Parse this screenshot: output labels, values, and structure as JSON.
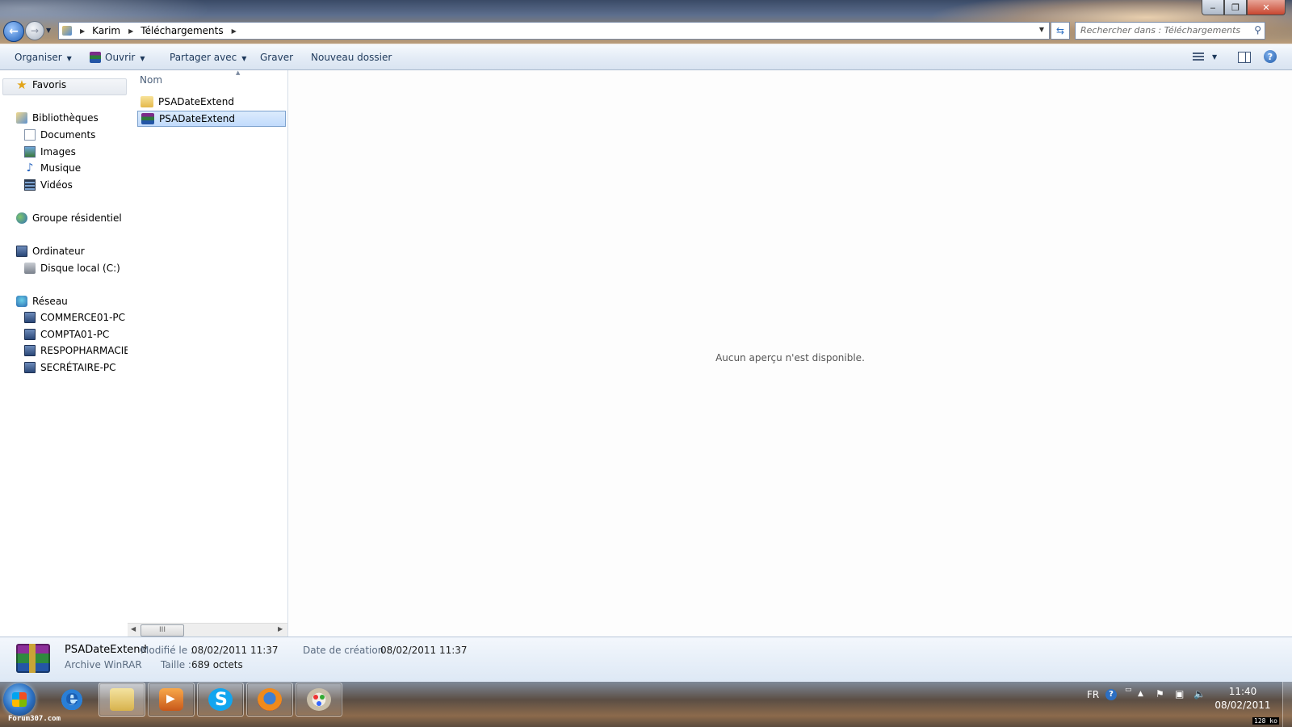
{
  "window": {
    "controls": {
      "minimize": "‒",
      "maximize": "❐",
      "close": "✕"
    }
  },
  "address_bar": {
    "crumbs": [
      "Karim",
      "Téléchargements"
    ],
    "search_placeholder": "Rechercher dans : Téléchargements"
  },
  "toolbar": {
    "organise": "Organiser",
    "open": "Ouvrir",
    "share": "Partager avec",
    "burn": "Graver",
    "new_folder": "Nouveau dossier"
  },
  "nav": {
    "favorites": "Favoris",
    "libraries": "Bibliothèques",
    "library_items": [
      "Documents",
      "Images",
      "Musique",
      "Vidéos"
    ],
    "homegroup": "Groupe résidentiel",
    "computer": "Ordinateur",
    "computer_items": [
      "Disque local (C:)"
    ],
    "network": "Réseau",
    "network_items": [
      "COMMERCE01-PC",
      "COMPTA01-PC",
      "RESPOPHARMACIE",
      "SECRÉTAIRE-PC"
    ]
  },
  "file_list": {
    "column_name": "Nom",
    "items": [
      {
        "name": "PSADateExtend",
        "type": "folder",
        "selected": false
      },
      {
        "name": "PSADateExtend",
        "type": "rar",
        "selected": true
      }
    ],
    "scroll_thumb": "III"
  },
  "preview": {
    "message": "Aucun aperçu n'est disponible."
  },
  "details": {
    "name": "PSADateExtend",
    "type": "Archive WinRAR",
    "modified_label": "Modifié le :",
    "modified_value": "08/02/2011 11:37",
    "size_label": "Taille :",
    "size_value": "689 octets",
    "created_label": "Date de création :",
    "created_value": "08/02/2011 11:37"
  },
  "taskbar": {
    "watermark": "Forum307.com",
    "language": "FR",
    "time": "11:40",
    "date": "08/02/2011",
    "size_badge": "128 ko"
  },
  "colors": {
    "selection": "#c1dbfc",
    "command_text": "#1e395b",
    "accent": "#2d6fc2"
  }
}
